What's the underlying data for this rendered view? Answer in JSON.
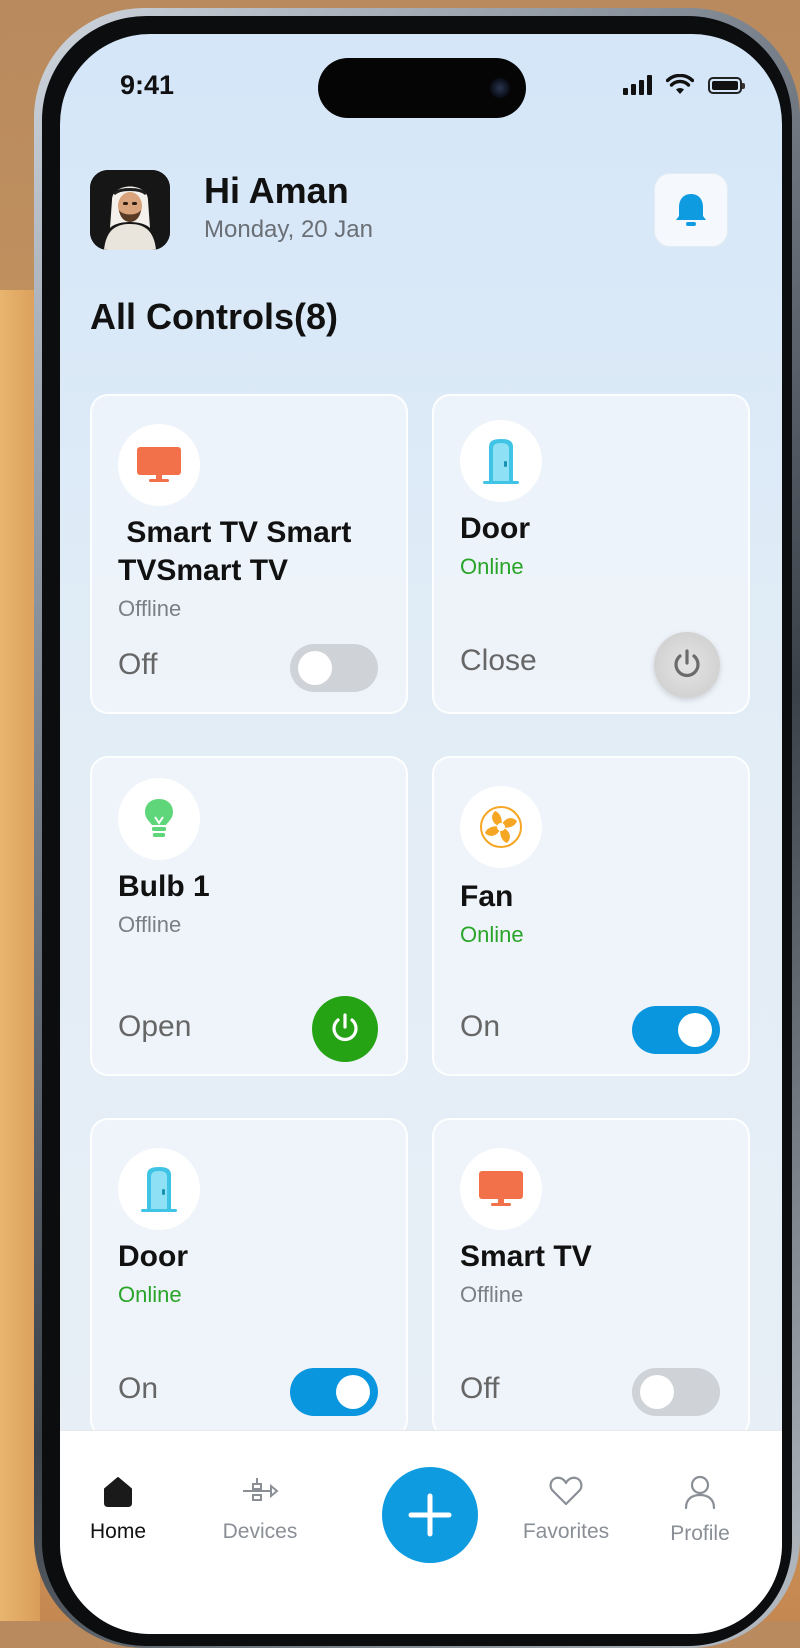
{
  "status_bar": {
    "time": "9:41"
  },
  "header": {
    "greeting": "Hi Aman",
    "date": "Monday, 20 Jan"
  },
  "section": {
    "title": "All Controls(8)"
  },
  "devices": [
    {
      "name": " Smart TV Smart TVSmart TV",
      "status": "Offline",
      "state": "Off",
      "control": "toggle",
      "on": false,
      "icon": "tv-icon"
    },
    {
      "name": "Door",
      "status": "Online",
      "state": "Close",
      "control": "power",
      "on": false,
      "icon": "door-icon"
    },
    {
      "name": "Bulb 1",
      "status": "Offline",
      "state": "Open",
      "control": "power",
      "on": true,
      "icon": "bulb-icon"
    },
    {
      "name": "Fan",
      "status": "Online",
      "state": "On",
      "control": "toggle",
      "on": true,
      "icon": "fan-icon"
    },
    {
      "name": "Door",
      "status": "Online",
      "state": "On",
      "control": "toggle",
      "on": true,
      "icon": "door-icon"
    },
    {
      "name": "Smart TV",
      "status": "Offline",
      "state": "Off",
      "control": "toggle",
      "on": false,
      "icon": "tv-icon"
    }
  ],
  "nav": {
    "home": "Home",
    "devices": "Devices",
    "favorites": "Favorites",
    "profile": "Profile"
  },
  "colors": {
    "accent": "#0f9be0",
    "online": "#2aa52a",
    "power_on": "#25a315",
    "tv": "#f2714a",
    "door": "#40c4e6",
    "bulb": "#5fd67a",
    "fan": "#f5a623"
  }
}
